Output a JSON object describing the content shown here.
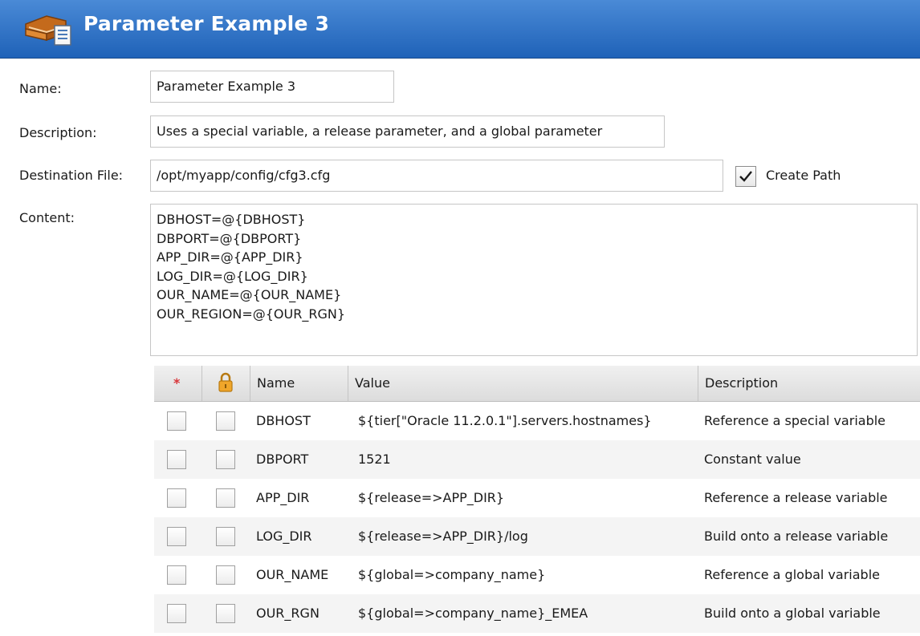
{
  "window": {
    "title": "Parameter Example 3",
    "icon": "book-document-icon"
  },
  "form": {
    "name_label": "Name:",
    "name_value": "Parameter Example 3",
    "description_label": "Description:",
    "description_value": "Uses a special variable, a release parameter, and a global parameter",
    "destination_label": "Destination File:",
    "destination_value": "/opt/myapp/config/cfg3.cfg",
    "create_path_label": "Create Path",
    "create_path_checked": true,
    "content_label": "Content:",
    "content_lines": [
      "DBHOST=@{DBHOST}",
      "DBPORT=@{DBPORT}",
      "APP_DIR=@{APP_DIR}",
      "LOG_DIR=@{LOG_DIR}",
      "OUR_NAME=@{OUR_NAME}",
      "OUR_REGION=@{OUR_RGN}"
    ]
  },
  "grid": {
    "required_header": "*",
    "lock_header_icon": "lock-icon",
    "columns": {
      "name": "Name",
      "value": "Value",
      "description": "Description"
    },
    "rows": [
      {
        "name": "DBHOST",
        "value": "${tier[\"Oracle 11.2.0.1\"].servers.hostnames}",
        "description": "Reference a special variable",
        "required": false,
        "locked": false
      },
      {
        "name": "DBPORT",
        "value": "1521",
        "description": "Constant value",
        "required": false,
        "locked": false
      },
      {
        "name": "APP_DIR",
        "value": "${release=>APP_DIR}",
        "description": "Reference a release variable",
        "required": false,
        "locked": false
      },
      {
        "name": "LOG_DIR",
        "value": "${release=>APP_DIR}/log",
        "description": "Build onto a release variable",
        "required": false,
        "locked": false
      },
      {
        "name": "OUR_NAME",
        "value": "${global=>company_name}",
        "description": "Reference a global variable",
        "required": false,
        "locked": false
      },
      {
        "name": "OUR_RGN",
        "value": "${global=>company_name}_EMEA",
        "description": "Build onto a global variable",
        "required": false,
        "locked": false
      }
    ]
  },
  "colors": {
    "titlebar_top": "#4a8ad6",
    "titlebar_bottom": "#1f62b8",
    "required_marker": "#d8363a",
    "lock_icon": "#e8a020"
  }
}
